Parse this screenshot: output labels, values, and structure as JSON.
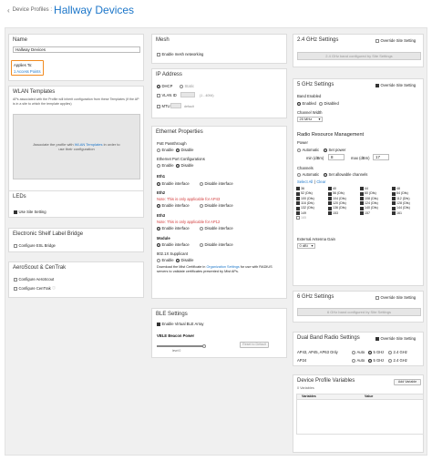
{
  "header": {
    "breadcrumb": "Device Profiles :",
    "title": "Hallway Devices"
  },
  "name": {
    "label": "Name",
    "value": "Hallway Devices"
  },
  "applies_to": {
    "label": "Applies To:",
    "link": "1 Access Points"
  },
  "wlan": {
    "title": "WLAN Templates",
    "desc": "APs associated with the Profile will inherit configuration from these Templates (if the AP is in a site to which the template applies)",
    "assoc_pre": "Associate the profile with ",
    "assoc_link": "WLAN Templates",
    "assoc_post": " in order to use their configuration"
  },
  "leds": {
    "title": "LEDs",
    "use_site": "Use Site Setting"
  },
  "esl": {
    "title": "Electronic Shelf Label Bridge",
    "configure": "Configure ESL Bridge"
  },
  "aeroscout": {
    "title": "AeroScout & CenTrak",
    "configure_aero": "Configure AeroScout",
    "configure_centrak": "Configure CenTrak"
  },
  "mesh": {
    "title": "Mesh",
    "enable": "Enable mesh networking"
  },
  "ip": {
    "title": "IP Address",
    "dhcp": "DHCP",
    "static": "Static",
    "vlan_label": "VLAN ID",
    "vlan_hint": "(1 - 4094)",
    "mtu": "MTU",
    "mtu_default": "default"
  },
  "ethernet": {
    "title": "Ethernet Properties",
    "poe": "PoE Passthrough",
    "enable": "Enable",
    "disable": "Disable",
    "port_config": "Ethernet Port Configurations",
    "eth1": "Eth1",
    "eth2": "Eth2",
    "eth3": "Eth3",
    "enable_interface": "Enable interface",
    "disable_interface": "Disable interface",
    "note2": "Note: This is only applicable for AP43",
    "note3": "Note: This is only applicable for AP12",
    "module": "Module",
    "supplicant": "802.1X Supplicant",
    "dl_pre": "Download the Mist Certificate in ",
    "dl_link": "Organization Settings",
    "dl_post": " for use with RADIUS servers to validate certificates presented by Mist APs."
  },
  "ble": {
    "title": "BLE Settings",
    "enable": "Enable Virtual BLE Array",
    "beacon_label": "VBLE Beacon Power",
    "reset": "Reset to Default",
    "level": "level 0"
  },
  "band24": {
    "title": "2.4 GHz Settings",
    "override": "Override Site Setting",
    "status": "2.4 GHz band configured by Site Settings"
  },
  "band5": {
    "title": "5 GHz Settings",
    "override": "Override Site Setting",
    "band_enabled": "Band Enabled",
    "enabled": "Enabled",
    "disabled": "Disabled",
    "width_label": "Channel Width",
    "width_value": "20 MHz",
    "rrm": "Radio Resource Management",
    "power": "Power",
    "automatic": "Automatic",
    "set_power": "Set power",
    "min_label": "min (dBm)",
    "min_value": "8",
    "max_label": "max (dBm)",
    "max_value": "17",
    "channels": "Channels",
    "ch_auto": "Automatic",
    "ch_set": "Set allowable channels",
    "select_all": "Select All",
    "clear": "Clear",
    "channel_list": [
      {
        "label": "36",
        "on": true
      },
      {
        "label": "40",
        "on": true
      },
      {
        "label": "44",
        "on": true
      },
      {
        "label": "48",
        "on": true
      },
      {
        "label": "52 (Dfs)",
        "on": true
      },
      {
        "label": "56 (Dfs)",
        "on": true
      },
      {
        "label": "60 (Dfs)",
        "on": true
      },
      {
        "label": "64 (Dfs)",
        "on": true
      },
      {
        "label": "100 (Dfs)",
        "on": true
      },
      {
        "label": "104 (Dfs)",
        "on": true
      },
      {
        "label": "108 (Dfs)",
        "on": true
      },
      {
        "label": "112 (Dfs)",
        "on": true
      },
      {
        "label": "116 (Dfs)",
        "on": true
      },
      {
        "label": "120 (Dfs)",
        "on": true
      },
      {
        "label": "124 (Dfs)",
        "on": true
      },
      {
        "label": "128 (Dfs)",
        "on": true
      },
      {
        "label": "132 (Dfs)",
        "on": true
      },
      {
        "label": "136 (Dfs)",
        "on": true
      },
      {
        "label": "140 (Dfs)",
        "on": true
      },
      {
        "label": "144 (Dfs)",
        "on": true
      },
      {
        "label": "149",
        "on": true
      },
      {
        "label": "153",
        "on": true
      },
      {
        "label": "157",
        "on": true
      },
      {
        "label": "161",
        "on": true
      },
      {
        "label": "165",
        "on": false
      }
    ],
    "antenna_label": "External Antenna Gain",
    "antenna_value": "0 dBi"
  },
  "band6": {
    "title": "6 GHz Settings",
    "override": "Override Site Setting",
    "status": "6 GHz band configured by Site Settings"
  },
  "dual": {
    "title": "Dual Band Radio Settings",
    "override": "Override Site Setting",
    "row1": "AP43, AP45, AP63 Only",
    "row2": "AP24",
    "auto": "Auto",
    "ghz5": "5 GHz",
    "ghz24": "2.4 GHz"
  },
  "vars": {
    "title": "Device Profile Variables",
    "add": "Add Variable",
    "count": "0 Variables",
    "col1": "Variables",
    "col2": "Value"
  }
}
